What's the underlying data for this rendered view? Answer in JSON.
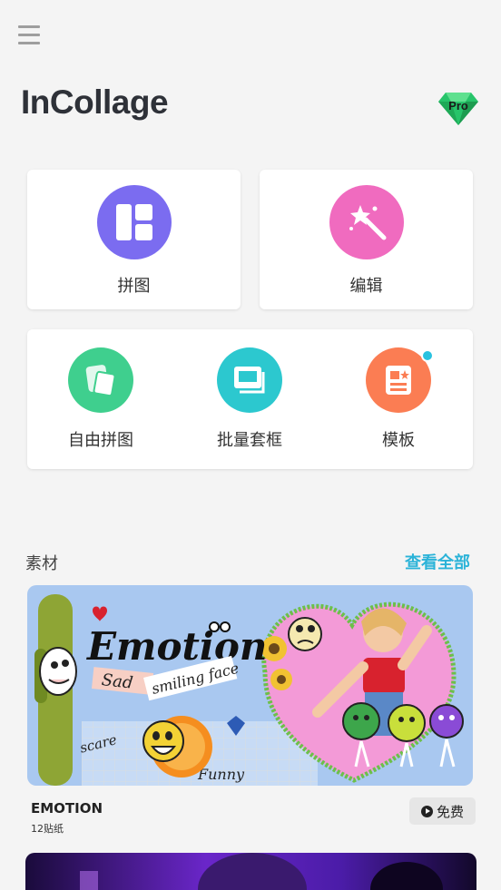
{
  "header": {
    "logo_text": "InCollage",
    "pro_label": "Pro"
  },
  "tiles": [
    {
      "label": "拼图",
      "icon": "layout-grid-icon",
      "color": "#7b6cf0"
    },
    {
      "label": "编辑",
      "icon": "magic-wand-icon",
      "color": "#f06bbf"
    }
  ],
  "tools": [
    {
      "label": "自由拼图",
      "icon": "freestyle-icon",
      "color": "#3fcf8e"
    },
    {
      "label": "批量套框",
      "icon": "batch-frame-icon",
      "color": "#2cc8cf"
    },
    {
      "label": "模板",
      "icon": "template-icon",
      "color": "#fb7d53"
    }
  ],
  "materials": {
    "title": "素材",
    "see_all": "查看全部",
    "packs": [
      {
        "name": "EMOTION",
        "count": "12贴纸",
        "price": "免费",
        "banner": {
          "title": "Emotion",
          "sticker_sad": "Sad",
          "sticker_smiling": "smiling face",
          "sticker_scare": "scare",
          "sticker_funny": "Funny"
        }
      }
    ]
  }
}
